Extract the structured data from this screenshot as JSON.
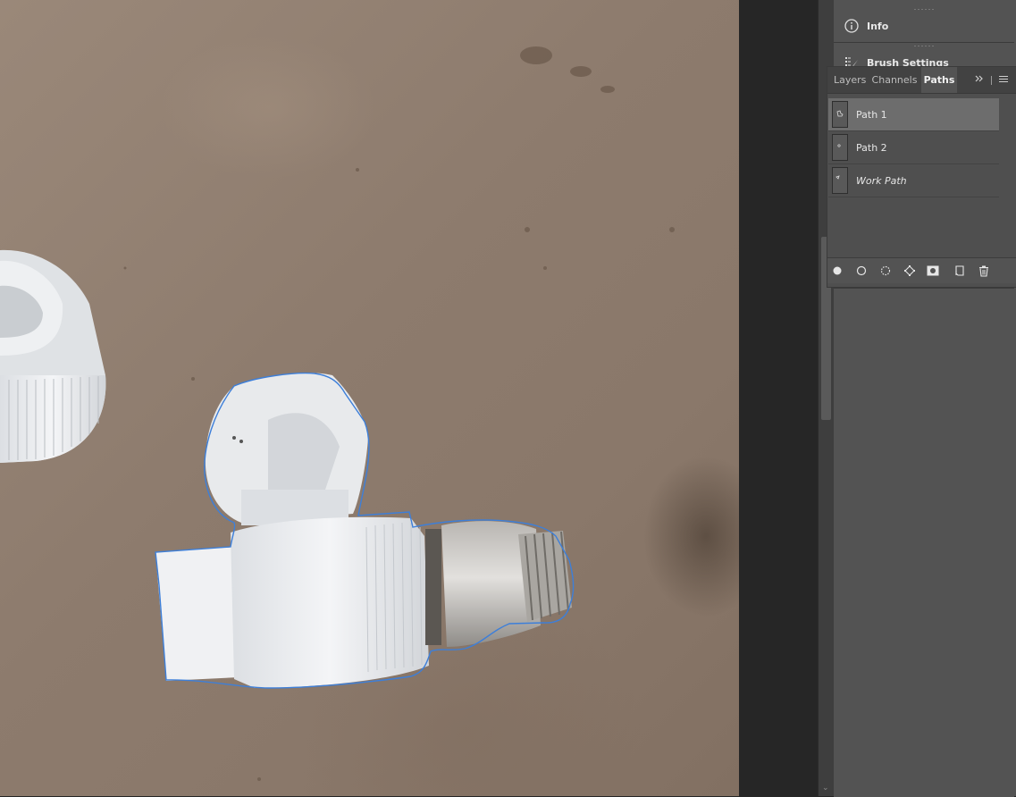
{
  "panels": {
    "info": {
      "label": "Info",
      "icon": "info-icon"
    },
    "brush_settings": {
      "label": "Brush Settings",
      "icon": "brush-settings-icon"
    }
  },
  "tabs": [
    {
      "label": "Layers",
      "active": false
    },
    {
      "label": "Channels",
      "active": false
    },
    {
      "label": "Paths",
      "active": true
    }
  ],
  "tab_menu": {
    "expand_icon": "double-chevron-icon",
    "menu_icon": "panel-menu-icon"
  },
  "paths": [
    {
      "name": "Path 1",
      "selected": true,
      "italic": false
    },
    {
      "name": "Path 2",
      "selected": false,
      "italic": false
    },
    {
      "name": "Work Path",
      "selected": false,
      "italic": true
    }
  ],
  "footer_buttons": [
    "fill-path-icon",
    "stroke-path-icon",
    "load-as-selection-icon",
    "make-work-path-icon",
    "add-mask-icon",
    "new-path-icon",
    "delete-path-icon"
  ],
  "colors": {
    "path_outline": "#3d7fd9",
    "selected_row": "#6d6d6d",
    "panel_bg": "#535353"
  }
}
